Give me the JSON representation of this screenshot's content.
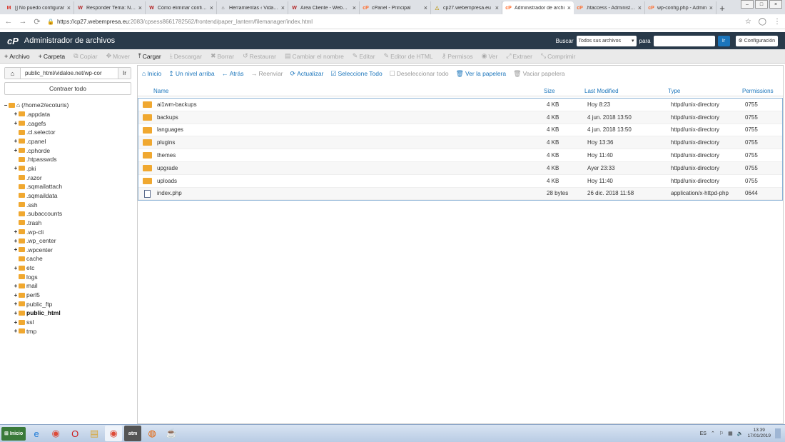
{
  "browser": {
    "tabs": [
      {
        "label": "[] No puedo configurar",
        "icon": "gmail-icon",
        "active": false
      },
      {
        "label": "Responder Tema: No p",
        "icon": "webempresa-icon",
        "active": false
      },
      {
        "label": "Cómo eliminar configur",
        "icon": "webempresa-icon",
        "active": false
      },
      {
        "label": "Herramientas ‹ Vidaloe",
        "icon": "wordpress-icon",
        "active": false
      },
      {
        "label": "Área Cliente - Webemp",
        "icon": "webempresa-icon",
        "active": false
      },
      {
        "label": "cPanel - Principal",
        "icon": "cpanel-icon",
        "active": false
      },
      {
        "label": "cp27.webempresa.eu",
        "icon": "generic-icon",
        "active": false
      },
      {
        "label": "Administrador de archi",
        "icon": "cpanel-icon",
        "active": true
      },
      {
        "label": ".htaccess - Administrac",
        "icon": "cpanel-icon",
        "active": false
      },
      {
        "label": "wp-config.php - Admin",
        "icon": "cpanel-icon",
        "active": false
      }
    ],
    "url_host": "https://cp27.webempresa.eu",
    "url_rest": ":2083/cpsess8661782562/frontend/paper_lantern/filemanager/index.html"
  },
  "header": {
    "logo": "cP",
    "title": "Administrador de archivos",
    "search_label": "Buscar",
    "search_scope": "Todos sus archivos",
    "for_label": "para",
    "go_label": "Ir",
    "settings_label": "Configuración"
  },
  "toolbar": [
    {
      "name": "new-file",
      "icon": "+",
      "label": "Archivo",
      "enabled": true
    },
    {
      "name": "new-folder",
      "icon": "+",
      "label": "Carpeta",
      "enabled": true
    },
    {
      "name": "copy",
      "icon": "⧉",
      "label": "Copiar",
      "enabled": false
    },
    {
      "name": "move",
      "icon": "✥",
      "label": "Mover",
      "enabled": false
    },
    {
      "name": "upload",
      "icon": "⤒",
      "label": "Cargar",
      "enabled": true
    },
    {
      "name": "download",
      "icon": "⤓",
      "label": "Descargar",
      "enabled": false
    },
    {
      "name": "delete",
      "icon": "✖",
      "label": "Borrar",
      "enabled": false
    },
    {
      "name": "restore",
      "icon": "↺",
      "label": "Restaurar",
      "enabled": false
    },
    {
      "name": "rename",
      "icon": "▤",
      "label": "Cambiar el nombre",
      "enabled": false
    },
    {
      "name": "edit",
      "icon": "✎",
      "label": "Editar",
      "enabled": false
    },
    {
      "name": "html-editor",
      "icon": "✎",
      "label": "Editor de HTML",
      "enabled": false
    },
    {
      "name": "permissions",
      "icon": "⚷",
      "label": "Permisos",
      "enabled": false
    },
    {
      "name": "view",
      "icon": "◉",
      "label": "Ver",
      "enabled": false
    },
    {
      "name": "extract",
      "icon": "⤢",
      "label": "Extraer",
      "enabled": false
    },
    {
      "name": "compress",
      "icon": "⤡",
      "label": "Comprimir",
      "enabled": false
    }
  ],
  "sidebar": {
    "path_value": "public_html/vidaloe.net/wp-cor",
    "go_label": "Ir",
    "collapse_label": "Contraer todo",
    "root_label": "(/home2/ecoturis)",
    "tree": [
      {
        "label": ".appdata",
        "exp": true,
        "bold": false
      },
      {
        "label": ".cagefs",
        "exp": true,
        "bold": false
      },
      {
        "label": ".cl.selector",
        "exp": false,
        "bold": false
      },
      {
        "label": ".cpanel",
        "exp": true,
        "bold": false
      },
      {
        "label": ".cphorde",
        "exp": true,
        "bold": false
      },
      {
        "label": ".htpasswds",
        "exp": false,
        "bold": false
      },
      {
        "label": ".pki",
        "exp": true,
        "bold": false
      },
      {
        "label": ".razor",
        "exp": false,
        "bold": false
      },
      {
        "label": ".sqmailattach",
        "exp": false,
        "bold": false
      },
      {
        "label": ".sqmaildata",
        "exp": false,
        "bold": false
      },
      {
        "label": ".ssh",
        "exp": false,
        "bold": false
      },
      {
        "label": ".subaccounts",
        "exp": false,
        "bold": false
      },
      {
        "label": ".trash",
        "exp": false,
        "bold": false
      },
      {
        "label": ".wp-cli",
        "exp": true,
        "bold": false
      },
      {
        "label": ".wp_center",
        "exp": true,
        "bold": false
      },
      {
        "label": ".wpcenter",
        "exp": true,
        "bold": false
      },
      {
        "label": "cache",
        "exp": false,
        "bold": false
      },
      {
        "label": "etc",
        "exp": true,
        "bold": false
      },
      {
        "label": "logs",
        "exp": false,
        "bold": false
      },
      {
        "label": "mail",
        "exp": true,
        "bold": false
      },
      {
        "label": "perl5",
        "exp": true,
        "bold": false
      },
      {
        "label": "public_ftp",
        "exp": true,
        "bold": false
      },
      {
        "label": "public_html",
        "exp": true,
        "bold": true
      },
      {
        "label": "ssl",
        "exp": true,
        "bold": false
      },
      {
        "label": "tmp",
        "exp": true,
        "bold": false
      }
    ]
  },
  "nav": [
    {
      "name": "home",
      "icon": "⌂",
      "label": "Inicio",
      "enabled": true
    },
    {
      "name": "up-one-level",
      "icon": "↥",
      "label": "Un nivel arriba",
      "enabled": true
    },
    {
      "name": "back",
      "icon": "←",
      "label": "Atrás",
      "enabled": true
    },
    {
      "name": "forward",
      "icon": "→",
      "label": "Reenviar",
      "enabled": false
    },
    {
      "name": "reload",
      "icon": "⟳",
      "label": "Actualizar",
      "enabled": true
    },
    {
      "name": "select-all",
      "icon": "☑",
      "label": "Seleccione Todo",
      "enabled": true
    },
    {
      "name": "unselect-all",
      "icon": "☐",
      "label": "Deseleccionar todo",
      "enabled": false
    },
    {
      "name": "view-trash",
      "icon": "🗑",
      "label": "Ver la papelera",
      "enabled": true
    },
    {
      "name": "empty-trash",
      "icon": "🗑",
      "label": "Vaciar papelera",
      "enabled": false
    }
  ],
  "table": {
    "columns": {
      "name": "Name",
      "size": "Size",
      "modified": "Last Modified",
      "type": "Type",
      "perms": "Permissions"
    },
    "rows": [
      {
        "name": "ai1wm-backups",
        "size": "4 KB",
        "modified": "Hoy 8:23",
        "type": "httpd/unix-directory",
        "perms": "0755",
        "kind": "folder"
      },
      {
        "name": "backups",
        "size": "4 KB",
        "modified": "4 jun. 2018 13:50",
        "type": "httpd/unix-directory",
        "perms": "0755",
        "kind": "folder"
      },
      {
        "name": "languages",
        "size": "4 KB",
        "modified": "4 jun. 2018 13:50",
        "type": "httpd/unix-directory",
        "perms": "0755",
        "kind": "folder"
      },
      {
        "name": "plugins",
        "size": "4 KB",
        "modified": "Hoy 13:36",
        "type": "httpd/unix-directory",
        "perms": "0755",
        "kind": "folder"
      },
      {
        "name": "themes",
        "size": "4 KB",
        "modified": "Hoy 11:40",
        "type": "httpd/unix-directory",
        "perms": "0755",
        "kind": "folder"
      },
      {
        "name": "upgrade",
        "size": "4 KB",
        "modified": "Ayer 23:33",
        "type": "httpd/unix-directory",
        "perms": "0755",
        "kind": "folder"
      },
      {
        "name": "uploads",
        "size": "4 KB",
        "modified": "Hoy 11:40",
        "type": "httpd/unix-directory",
        "perms": "0755",
        "kind": "folder"
      },
      {
        "name": "index.php",
        "size": "28 bytes",
        "modified": "26 dic. 2018 11:58",
        "type": "application/x-httpd-php",
        "perms": "0644",
        "kind": "file"
      }
    ]
  },
  "taskbar": {
    "start_label": "Inicio",
    "apps": [
      {
        "name": "internet-explorer",
        "glyph": "e",
        "color": "#1e7bd8"
      },
      {
        "name": "chrome",
        "glyph": "◉",
        "color": "#dd4b39"
      },
      {
        "name": "opera",
        "glyph": "O",
        "color": "#cc1b1b"
      },
      {
        "name": "file-explorer",
        "glyph": "▤",
        "color": "#d9a534"
      },
      {
        "name": "chrome-active",
        "glyph": "◉",
        "color": "#dd4b39"
      },
      {
        "name": "atm",
        "glyph": "atm",
        "color": "#333333"
      },
      {
        "name": "firefox",
        "glyph": "◍",
        "color": "#e66000"
      },
      {
        "name": "java",
        "glyph": "☕",
        "color": "#c03030"
      }
    ],
    "lang": "ES",
    "time": "13:39",
    "date": "17/01/2019"
  },
  "colors": {
    "link": "#1b75bb",
    "header": "#293a4a",
    "folder": "#f0a830"
  }
}
